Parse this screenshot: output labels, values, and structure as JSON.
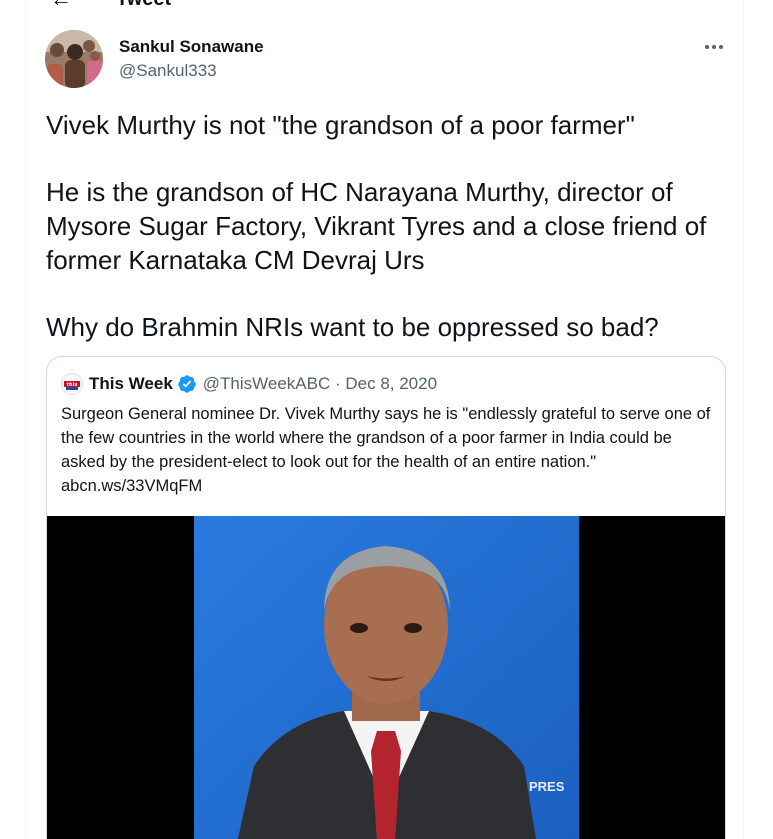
{
  "header": {
    "back_icon": "back-arrow-icon",
    "title": "Tweet"
  },
  "tweet": {
    "author": {
      "name": "Sankul Sonawane",
      "handle": "@Sankul333"
    },
    "more_icon": "more-horizontal-icon",
    "text": {
      "line1": "Vivek Murthy is not \"the grandson of a poor farmer\"",
      "para2": "He is the grandson of HC Narayana Murthy, director of Mysore Sugar Factory, Vikrant Tyres and a close friend of former Karnataka CM Devraj Urs",
      "para3": "Why do Brahmin NRIs want to be oppressed so bad?"
    }
  },
  "quote": {
    "logo_text": "this week",
    "name": "This Week",
    "verified_icon": "verified-badge-icon",
    "handle_date": "@ThisWeekABC · Dec 8, 2020",
    "text": "Surgeon General nominee Dr. Vivek Murthy says he is \"endlessly grateful to serve one of the few countries in the world where the grandson of a poor farmer in India could be asked by the president-elect to look out for the health of an entire nation.\" abcn.ws/33VMqFM",
    "media": {
      "overlay_text": "PRES"
    }
  },
  "colors": {
    "text_primary": "#0f1419",
    "text_secondary": "#536471",
    "verified_blue": "#1d9bf0",
    "border": "#cfd9de",
    "video_background": "#1f6fd0"
  }
}
